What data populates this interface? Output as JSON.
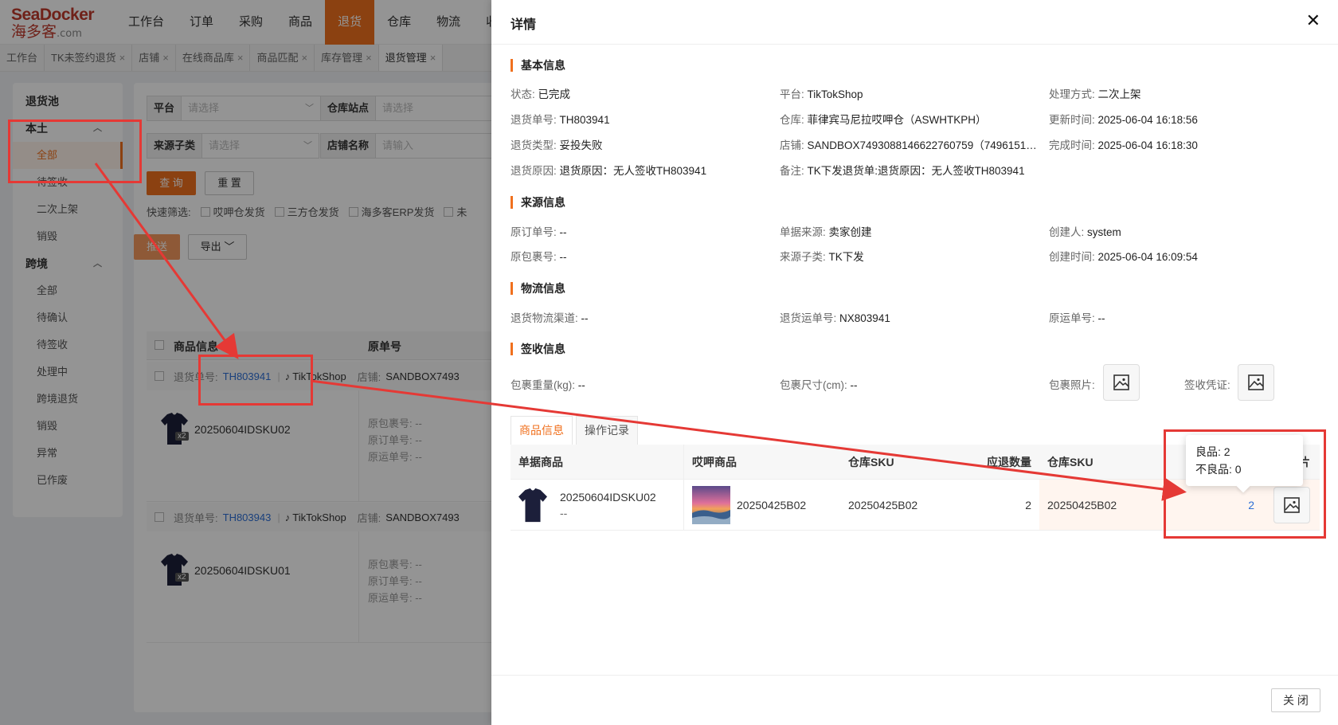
{
  "logo": {
    "brand": "SeaDocker",
    "cn": "海多客",
    "domain": ".com"
  },
  "topnav": [
    {
      "label": "工作台"
    },
    {
      "label": "订单"
    },
    {
      "label": "采购"
    },
    {
      "label": "商品"
    },
    {
      "label": "退货",
      "active": true
    },
    {
      "label": "仓库"
    },
    {
      "label": "物流"
    },
    {
      "label": "收款"
    }
  ],
  "tabs": [
    {
      "label": "工作台",
      "closable": false
    },
    {
      "label": "TK未签约退货",
      "closable": true
    },
    {
      "label": "店铺",
      "closable": true
    },
    {
      "label": "在线商品库",
      "closable": true
    },
    {
      "label": "商品匹配",
      "closable": true
    },
    {
      "label": "库存管理",
      "closable": true
    },
    {
      "label": "退货管理",
      "closable": true,
      "active": true
    }
  ],
  "sidebar": {
    "pool": "退货池",
    "group1": {
      "label": "本土",
      "items": [
        "全部",
        "待签收",
        "二次上架",
        "销毁"
      ]
    },
    "group2": {
      "label": "跨境",
      "items": [
        "全部",
        "待确认",
        "待签收",
        "处理中",
        "跨境退货",
        "销毁",
        "异常",
        "已作废"
      ]
    }
  },
  "filters": {
    "platform_label": "平台",
    "platform_placeholder": "请选择",
    "warehouse_label": "仓库站点",
    "warehouse_placeholder": "请选择",
    "source_label": "来源子类",
    "source_placeholder": "请选择",
    "shop_label": "店铺名称",
    "shop_placeholder": "请输入",
    "query_btn": "查 询",
    "reset_btn": "重 置"
  },
  "quick_filter": {
    "label": "快速筛选:",
    "options": [
      "哎呷仓发货",
      "三方仓发货",
      "海多客ERP发货",
      "未"
    ]
  },
  "actions": {
    "push": "推送",
    "export": "导出"
  },
  "list": {
    "col_product": "商品信息",
    "col_orig": "原单号",
    "records": [
      {
        "return_no_label": "退货单号:",
        "return_no": "TH803941",
        "platform": "TikTokShop",
        "shop_label": "店铺:",
        "shop": "SANDBOX7493",
        "sku": "20250604IDSKU02",
        "qty_badge": "x2",
        "orig_pkg": "原包裹号: --",
        "orig_order": "原订单号: --",
        "orig_ship": "原运单号: --"
      },
      {
        "return_no_label": "退货单号:",
        "return_no": "TH803943",
        "platform": "TikTokShop",
        "shop_label": "店铺:",
        "shop": "SANDBOX7493",
        "sku": "20250604IDSKU01",
        "qty_badge": "x2",
        "orig_pkg": "原包裹号: --",
        "orig_order": "原订单号: --",
        "orig_ship": "原运单号: --"
      }
    ]
  },
  "drawer": {
    "title": "详情",
    "basic": {
      "title": "基本信息",
      "status_k": "状态:",
      "status_v": "已完成",
      "platform_k": "平台:",
      "platform_v": "TikTokShop",
      "handle_k": "处理方式:",
      "handle_v": "二次上架",
      "return_no_k": "退货单号:",
      "return_no_v": "TH803941",
      "warehouse_k": "仓库:",
      "warehouse_v": "菲律宾马尼拉哎呷仓（ASWHTKPH）",
      "updated_k": "更新时间:",
      "updated_v": "2025-06-04 16:18:56",
      "type_k": "退货类型:",
      "type_v": "妥投失败",
      "shop_k": "店铺:",
      "shop_v": "SANDBOX7493088146622760759（7496151…",
      "done_k": "完成时间:",
      "done_v": "2025-06-04 16:18:30",
      "reason_k": "退货原因:",
      "reason_v": "退货原因：无人签收TH803941",
      "remark_k": "备注:",
      "remark_v": "TK下发退货单:退货原因：无人签收TH803941"
    },
    "source": {
      "title": "来源信息",
      "orig_order_k": "原订单号:",
      "orig_order_v": "--",
      "doc_src_k": "单据来源:",
      "doc_src_v": "卖家创建",
      "creator_k": "创建人:",
      "creator_v": "system",
      "orig_pkg_k": "原包裹号:",
      "orig_pkg_v": "--",
      "subcat_k": "来源子类:",
      "subcat_v": "TK下发",
      "created_k": "创建时间:",
      "created_v": "2025-06-04 16:09:54"
    },
    "logistics": {
      "title": "物流信息",
      "channel_k": "退货物流渠道:",
      "channel_v": "--",
      "waybill_k": "退货运单号:",
      "waybill_v": "NX803941",
      "orig_waybill_k": "原运单号:",
      "orig_waybill_v": "--"
    },
    "receipt": {
      "title": "签收信息",
      "weight_k": "包裹重量(kg):",
      "weight_v": "--",
      "size_k": "包裹尺寸(cm):",
      "size_v": "--",
      "photo_k": "包裹照片:",
      "proof_k": "签收凭证:"
    },
    "tabs": [
      {
        "label": "商品信息",
        "active": true
      },
      {
        "label": "操作记录"
      }
    ],
    "goods": {
      "headers": [
        "单据商品",
        "哎呷商品",
        "仓库SKU",
        "应退数量",
        "仓库SKU",
        "片"
      ],
      "row": {
        "doc_sku": "20250604IDSKU02",
        "doc_sub": "--",
        "ayi_sku": "20250425B02",
        "wh_sku": "20250425B02",
        "qty": "2",
        "wh_sku2": "20250425B02",
        "received": "2"
      }
    },
    "tooltip": {
      "good": "良品: 2",
      "bad": "不良品: 0"
    },
    "footer_close": "关 闭"
  }
}
